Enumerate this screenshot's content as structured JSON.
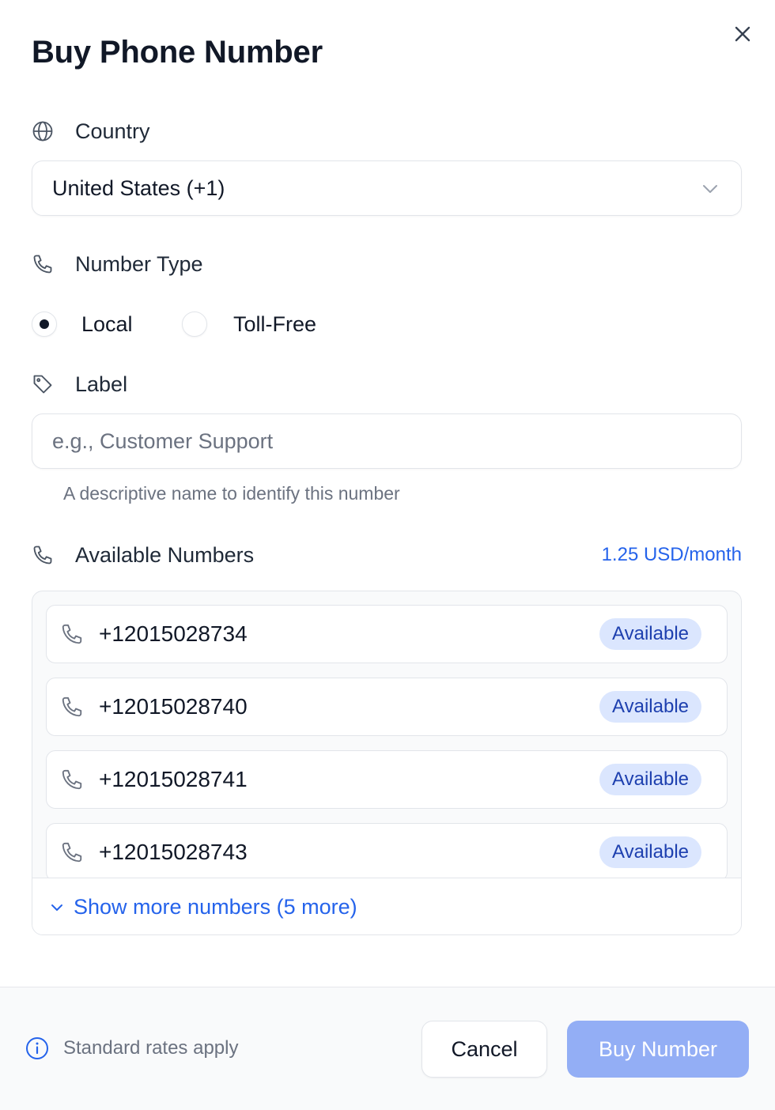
{
  "dialog": {
    "title": "Buy Phone Number",
    "close_icon": "close-icon"
  },
  "country": {
    "label": "Country",
    "icon": "globe-icon",
    "selected": "United States (+1)"
  },
  "number_type": {
    "label": "Number Type",
    "icon": "phone-icon",
    "options": [
      {
        "label": "Local",
        "selected": true
      },
      {
        "label": "Toll-Free",
        "selected": false
      }
    ]
  },
  "label_field": {
    "label": "Label",
    "icon": "tag-icon",
    "value": "",
    "placeholder": "e.g., Customer Support",
    "helper": "A descriptive name to identify this number"
  },
  "available": {
    "label": "Available Numbers",
    "icon": "phone-icon",
    "price": "1.25 USD/month",
    "numbers": [
      {
        "number": "+12015028734",
        "status": "Available"
      },
      {
        "number": "+12015028740",
        "status": "Available"
      },
      {
        "number": "+12015028741",
        "status": "Available"
      },
      {
        "number": "+12015028743",
        "status": "Available"
      }
    ],
    "show_more": "Show more numbers (5 more)"
  },
  "footer": {
    "info_icon": "info-icon",
    "note": "Standard rates apply",
    "cancel": "Cancel",
    "buy": "Buy Number"
  },
  "colors": {
    "accent": "#2563eb",
    "badge_bg": "#dbe6fe",
    "badge_text": "#1e40af",
    "buy_disabled": "#93aef5"
  }
}
